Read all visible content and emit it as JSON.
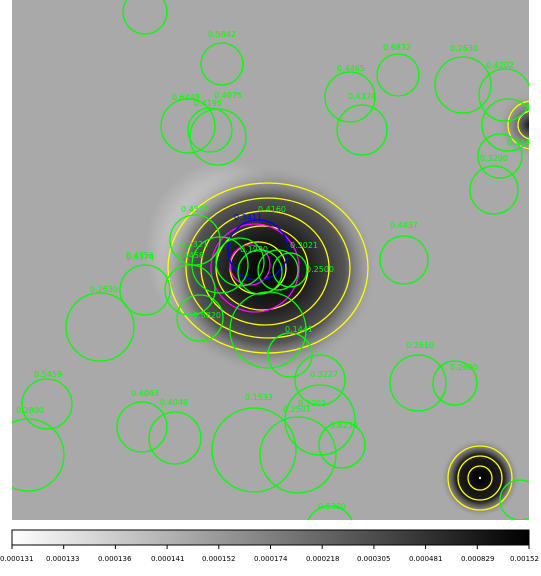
{
  "colors": {
    "green": "#00ff00",
    "yellow": "#ffff00",
    "magenta": "#ff00ff",
    "blue": "#0000ff",
    "background_gray": "#a9a9a9"
  },
  "image_view": {
    "source_labels": [
      "0.5842",
      "0.6832",
      "0.2630",
      "0.4202",
      "0.4465",
      "0.6448",
      "0.4075",
      "0.4195",
      "0.4374",
      "0.3290",
      "0.4323",
      "0.3411",
      "0.4160",
      "0.3321",
      "0.4458",
      "0.4374",
      "0.4356",
      "0.2630",
      "0.3021",
      "0.2500",
      "0.1980",
      "0.5820",
      "0.1441",
      "0.2610",
      "0.2600",
      "0.5459",
      "0.2800",
      "0.4043",
      "0.4048",
      "0.1533",
      "0.2501",
      "0.3202",
      "0.4230",
      "0.5380",
      "0.3227",
      "0.4437",
      "0.2441"
    ]
  },
  "colorbar": {
    "tick_labels": [
      "0.000131",
      "0.000133",
      "0.000136",
      "0.000141",
      "0.000152",
      "0.000174",
      "0.000218",
      "0.000305",
      "0.000481",
      "0.000829",
      "0.00152"
    ]
  }
}
